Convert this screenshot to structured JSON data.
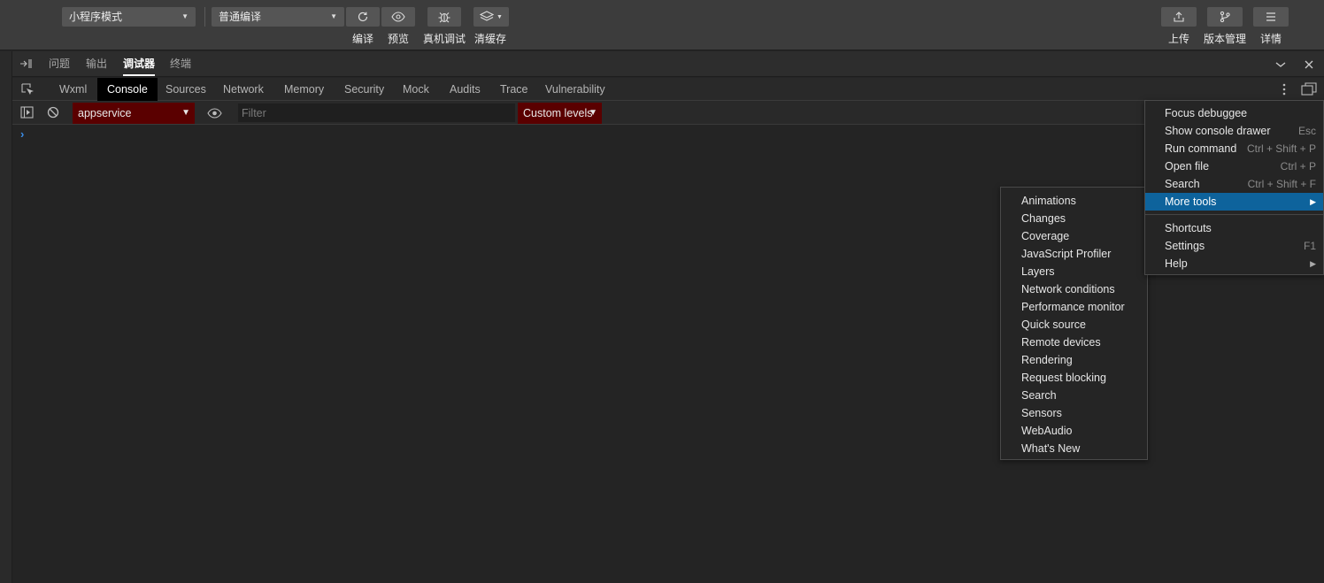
{
  "toolbar": {
    "mode_select": "小程序模式",
    "compile_select": "普通编译",
    "compile_label": "编译",
    "preview_label": "预览",
    "device_debug_label": "真机调试",
    "clear_cache_label": "清缓存",
    "upload_label": "上传",
    "version_label": "版本管理",
    "details_label": "详情"
  },
  "panel_tabs": [
    "问题",
    "输出",
    "调试器",
    "终端"
  ],
  "active_panel_tab": "调试器",
  "devtools_tabs": [
    "Wxml",
    "Console",
    "Sources",
    "Network",
    "Memory",
    "Security",
    "Mock",
    "Audits",
    "Trace",
    "Vulnerability"
  ],
  "active_devtools_tab": "Console",
  "console_toolbar": {
    "context_select": "appservice",
    "filter_placeholder": "Filter",
    "levels_select": "Custom levels"
  },
  "console": {
    "prompt_symbol": "›"
  },
  "main_menu": {
    "items": [
      {
        "label": "Focus debuggee",
        "shortcut": ""
      },
      {
        "label": "Show console drawer",
        "shortcut": "Esc"
      },
      {
        "label": "Run command",
        "shortcut": "Ctrl + Shift + P"
      },
      {
        "label": "Open file",
        "shortcut": "Ctrl + P"
      },
      {
        "label": "Search",
        "shortcut": "Ctrl + Shift + F"
      },
      {
        "label": "More tools",
        "shortcut": "",
        "submenu": true,
        "highlighted": true
      },
      {
        "label": "Shortcuts",
        "shortcut": ""
      },
      {
        "label": "Settings",
        "shortcut": "F1"
      },
      {
        "label": "Help",
        "shortcut": "",
        "submenu": true
      }
    ]
  },
  "more_tools_submenu": {
    "items": [
      "Animations",
      "Changes",
      "Coverage",
      "JavaScript Profiler",
      "Layers",
      "Network conditions",
      "Performance monitor",
      "Quick source",
      "Remote devices",
      "Rendering",
      "Request blocking",
      "Search",
      "Sensors",
      "WebAudio",
      "What's New"
    ]
  },
  "colors": {
    "highlight": "#0e639c",
    "context_select_bg": "#5a0000",
    "prompt": "#3b8eea"
  }
}
